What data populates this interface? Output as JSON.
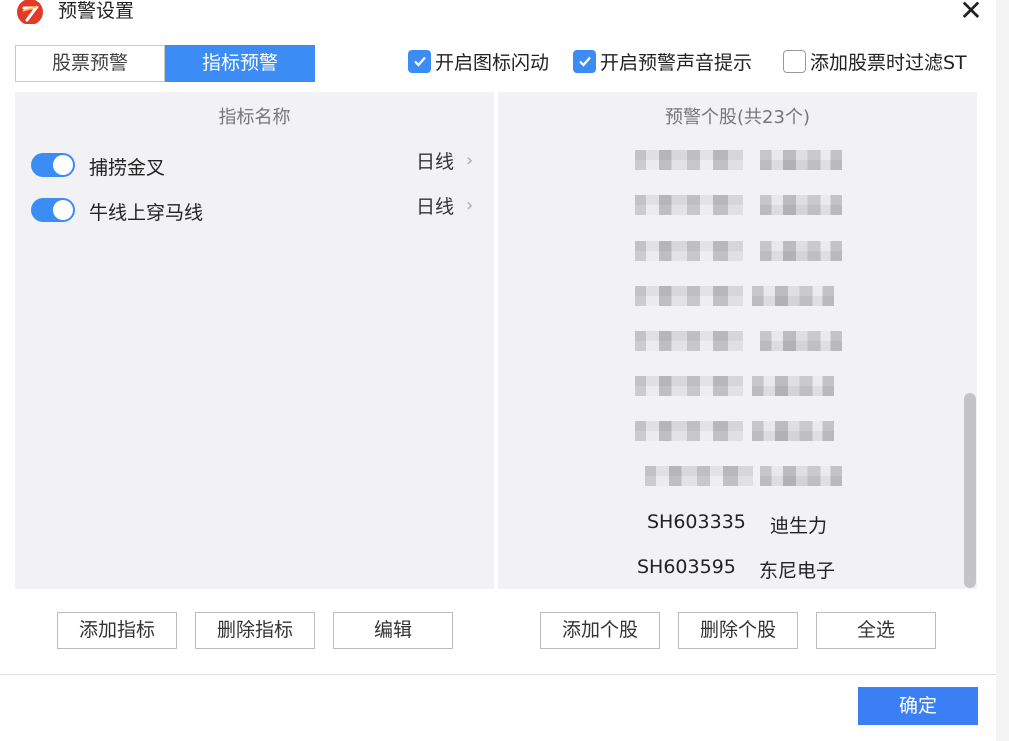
{
  "window": {
    "title": "预警设置",
    "close_glyph": "✕"
  },
  "tabs": [
    {
      "label": "股票预警",
      "active": false
    },
    {
      "label": "指标预警",
      "active": true
    }
  ],
  "options": [
    {
      "label": "开启图标闪动",
      "checked": true
    },
    {
      "label": "开启预警声音提示",
      "checked": true
    },
    {
      "label": "添加股票时过滤ST",
      "checked": false
    }
  ],
  "indicators": {
    "header": "指标名称",
    "items": [
      {
        "name": "捕捞金叉",
        "period": "日线",
        "enabled": true
      },
      {
        "name": "牛线上穿马线",
        "period": "日线",
        "enabled": true
      }
    ]
  },
  "stocks": {
    "header": "预警个股(共23个)",
    "visible_items": [
      {
        "code": "SH603335",
        "name": "迪生力"
      },
      {
        "code": "SH603595",
        "name": "东尼电子"
      }
    ]
  },
  "buttons": {
    "add_indicator": "添加指标",
    "delete_indicator": "删除指标",
    "edit": "编辑",
    "add_stock": "添加个股",
    "delete_stock": "删除个股",
    "select_all": "全选",
    "ok": "确定"
  },
  "colors": {
    "accent": "#3b8cf5",
    "panel_bg": "#f2f2f4",
    "ok_button": "#3b7ff5"
  },
  "icons": {
    "app": "app-logo-icon",
    "close": "close-icon",
    "chevron": "chevron-right-icon",
    "check": "checkmark-icon"
  }
}
